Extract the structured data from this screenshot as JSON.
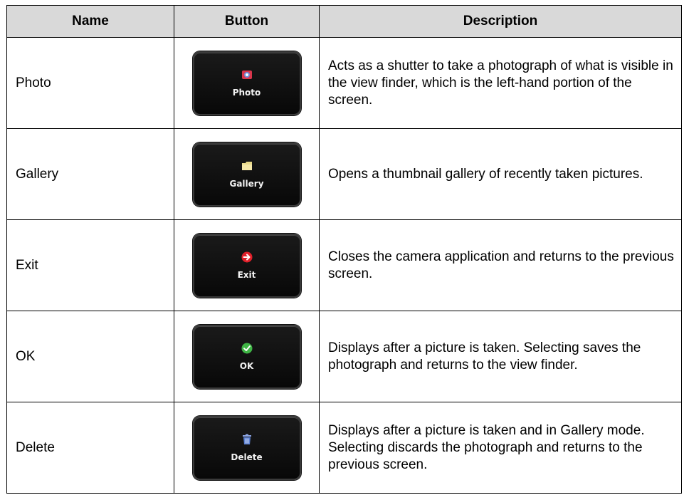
{
  "headers": {
    "name": "Name",
    "button": "Button",
    "description": "Description"
  },
  "rows": [
    {
      "name": "Photo",
      "button_label": "Photo",
      "icon": "camera-icon",
      "description": "Acts as a shutter to take a photograph of what is visible in the view finder, which is the left-hand portion of the screen."
    },
    {
      "name": "Gallery",
      "button_label": "Gallery",
      "icon": "folder-icon",
      "description": "Opens a thumbnail gallery of recently taken pictures."
    },
    {
      "name": "Exit",
      "button_label": "Exit",
      "icon": "exit-arrow-icon",
      "description": "Closes the camera application and returns to the previous screen."
    },
    {
      "name": "OK",
      "button_label": "OK",
      "icon": "checkmark-icon",
      "description": "Displays after a picture is taken. Selecting saves the photograph and returns to the view finder."
    },
    {
      "name": "Delete",
      "button_label": "Delete",
      "icon": "trash-icon",
      "description": "Displays after a picture is taken and in Gallery mode. Selecting discards the photograph and returns to the previous screen."
    }
  ],
  "colors": {
    "header_bg": "#d9d9d9",
    "button_bg": "#0d0d0d",
    "photo_icon": "#d9364c",
    "gallery_icon": "#e8d98a",
    "exit_icon": "#e0202a",
    "ok_icon": "#3fb545",
    "delete_icon": "#5a7fd1"
  }
}
